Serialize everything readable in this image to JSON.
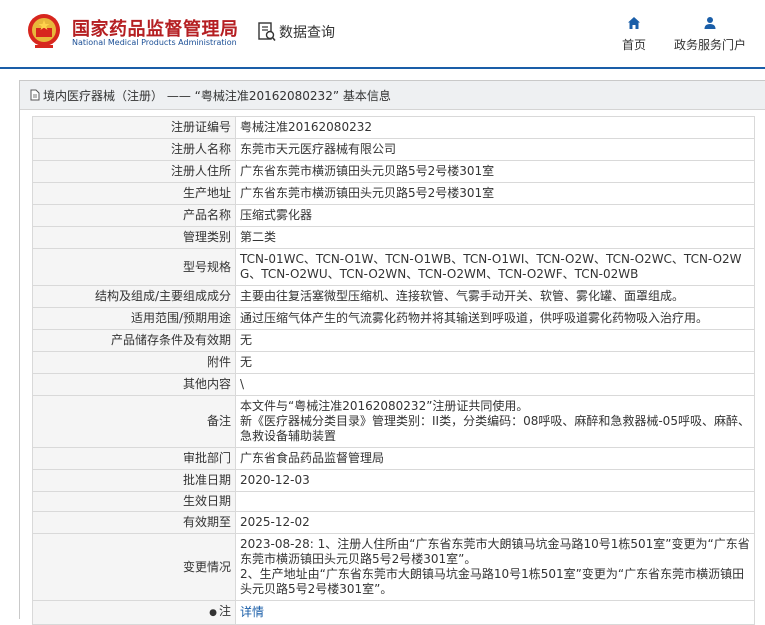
{
  "header": {
    "logo_cn": "国家药品监督管理局",
    "logo_en": "National Medical Products Administration",
    "query_label": "数据查询",
    "nav": [
      {
        "label": "首页",
        "icon": "home-icon"
      },
      {
        "label": "政务服务门户",
        "icon": "user-icon"
      }
    ]
  },
  "breadcrumb": "境内医疗器械（注册） —— “粤械注准20162080232” 基本信息",
  "rows": [
    {
      "key": "注册证编号",
      "value": "粤械注准20162080232"
    },
    {
      "key": "注册人名称",
      "value": "东莞市天元医疗器械有限公司"
    },
    {
      "key": "注册人住所",
      "value": "广东省东莞市横沥镇田头元贝路5号2号楼301室"
    },
    {
      "key": "生产地址",
      "value": "广东省东莞市横沥镇田头元贝路5号2号楼301室"
    },
    {
      "key": "产品名称",
      "value": "压缩式雾化器"
    },
    {
      "key": "管理类别",
      "value": "第二类"
    },
    {
      "key": "型号规格",
      "value": "TCN-01WC、TCN-O1W、TCN-O1WB、TCN-O1WI、TCN-O2W、TCN-O2WC、TCN-O2WG、TCN-O2WU、TCN-O2WN、TCN-O2WM、TCN-O2WF、TCN-02WB"
    },
    {
      "key": "结构及组成/主要组成成分",
      "value": "主要由往复活塞微型压缩机、连接软管、气雾手动开关、软管、雾化罐、面罩组成。"
    },
    {
      "key": "适用范围/预期用途",
      "value": "通过压缩气体产生的气流雾化药物并将其输送到呼吸道，供呼吸道雾化药物吸入治疗用。"
    },
    {
      "key": "产品储存条件及有效期",
      "value": "无"
    },
    {
      "key": "附件",
      "value": "无"
    },
    {
      "key": "其他内容",
      "value": "\\"
    },
    {
      "key": "备注",
      "value": "本文件与“粤械注准20162080232”注册证共同使用。\n新《医疗器械分类目录》管理类别：II类，分类编码：08呼吸、麻醉和急救器械-05呼吸、麻醉、急救设备辅助装置"
    },
    {
      "key": "审批部门",
      "value": "广东省食品药品监督管理局"
    },
    {
      "key": "批准日期",
      "value": "2020-12-03"
    },
    {
      "key": "生效日期",
      "value": ""
    },
    {
      "key": "有效期至",
      "value": "2025-12-02"
    },
    {
      "key": "变更情况",
      "value": "2023-08-28: 1、注册人住所由“广东省东莞市大朗镇马坑金马路10号1栋501室”变更为“广东省东莞市横沥镇田头元贝路5号2号楼301室”。\n2、生产地址由“广东省东莞市大朗镇马坑金马路10号1栋501室”变更为“广东省东莞市横沥镇田头元贝路5号2号楼301室”。"
    }
  ],
  "note_row": {
    "key": "注",
    "value": "详情"
  },
  "colors": {
    "brand_red": "#b51f22",
    "brand_blue": "#1a5ea8",
    "key_bg": "#f5f5f5"
  }
}
